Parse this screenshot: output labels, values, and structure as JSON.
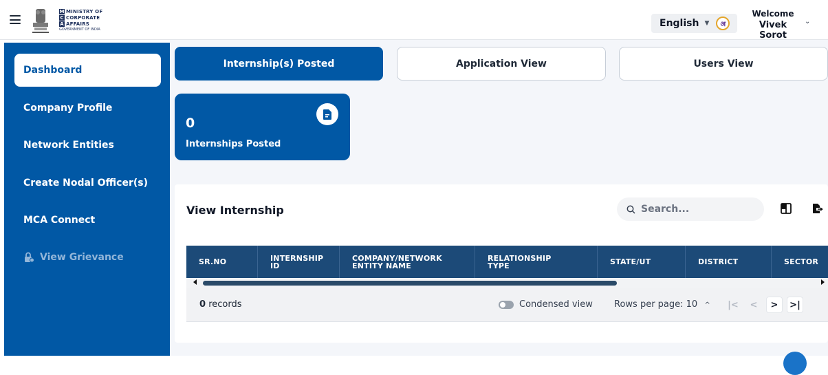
{
  "header": {
    "logo": {
      "line1_box": "M",
      "line1": "MINISTRY OF",
      "line2_box": "C",
      "line2": "CORPORATE",
      "line3_box": "A",
      "line3": "AFFAIRS",
      "gov": "GOVERNMENT OF INDIA"
    },
    "language": {
      "label": "English",
      "icon_glyph": "अ"
    },
    "user": {
      "welcome": "Welcome",
      "name": "Vivek Sorot"
    }
  },
  "sidebar": {
    "items": [
      {
        "label": "Dashboard",
        "active": true
      },
      {
        "label": "Company Profile"
      },
      {
        "label": "Network Entities"
      },
      {
        "label": "Create Nodal Officer(s)"
      },
      {
        "label": "MCA Connect"
      },
      {
        "label": "View Grievance",
        "disabled": true
      }
    ]
  },
  "tabs": [
    {
      "label": "Internship(s) Posted",
      "active": true
    },
    {
      "label": "Application View"
    },
    {
      "label": "Users View"
    }
  ],
  "stat": {
    "value": "0",
    "label": "Internships Posted"
  },
  "table_panel": {
    "title": "View Internship",
    "search_placeholder": "Search...",
    "columns": [
      {
        "line1": "SR.NO",
        "line2": ""
      },
      {
        "line1": "INTERNSHIP",
        "line2": "ID"
      },
      {
        "line1": "COMPANY/NETWORK",
        "line2": "ENTITY NAME"
      },
      {
        "line1": "RELATIONSHIP",
        "line2": "TYPE"
      },
      {
        "line1": "STATE/UT",
        "line2": ""
      },
      {
        "line1": "DISTRICT",
        "line2": ""
      },
      {
        "line1": "SECTOR",
        "line2": ""
      }
    ],
    "rows": [],
    "records_count": "0",
    "records_label": "records",
    "condensed_label": "Condensed view",
    "rows_per_page": "Rows per page: 10",
    "rows_caret": "^"
  },
  "colors": {
    "primary": "#0158a5",
    "table_header": "#1c4a78",
    "background": "#f4f6fa"
  },
  "icons": [
    "menu-icon",
    "emblem-icon",
    "language-icon",
    "chevron-down-icon",
    "lock-icon",
    "document-icon",
    "search-icon",
    "columns-icon",
    "export-icon",
    "first-page-icon",
    "prev-page-icon",
    "next-page-icon",
    "last-page-icon"
  ]
}
